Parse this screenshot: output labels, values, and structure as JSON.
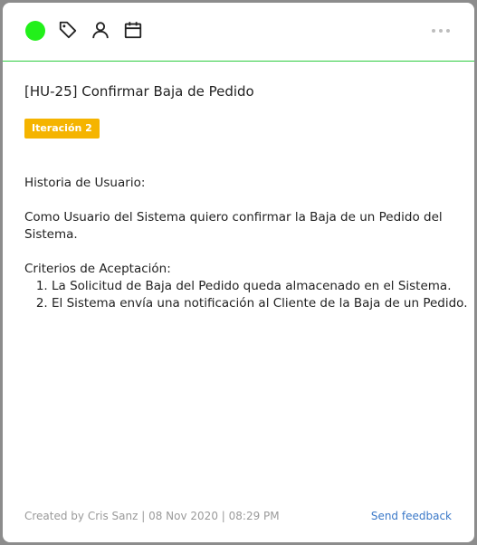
{
  "toolbar": {
    "status_color": "#22f01a",
    "icons": [
      "tag-icon",
      "user-icon",
      "calendar-icon",
      "more-icon"
    ]
  },
  "story": {
    "title": "[HU-25] Confirmar Baja de Pedido",
    "badge": "Iteración 2",
    "badge_color": "#f5b400",
    "heading": "Historia de Usuario:",
    "description_line1": "Como Usuario del Sistema quiero confirmar la Baja de un Pedido del",
    "description_line2": "Sistema.",
    "criteria_heading": "Criterios de Aceptación:",
    "criteria": [
      "La Solicitud de Baja del Pedido queda almacenado en el Sistema.",
      "El Sistema envía una notificación al Cliente de la Baja de un Pedido."
    ]
  },
  "footer": {
    "created": "Created by Cris Sanz | 08 Nov 2020 | 08:29 PM",
    "feedback": "Send feedback"
  }
}
